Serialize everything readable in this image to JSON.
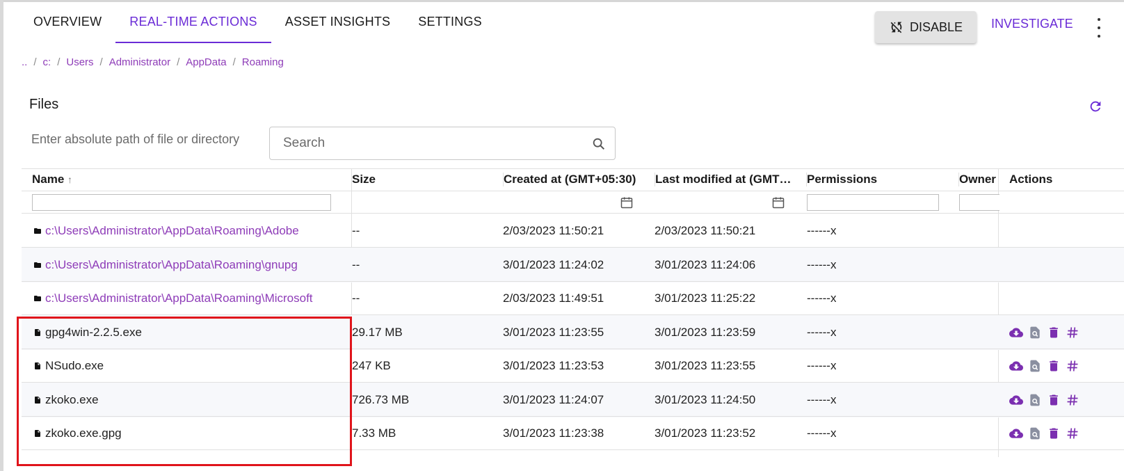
{
  "tabs": [
    "OVERVIEW",
    "REAL-TIME ACTIONS",
    "ASSET INSIGHTS",
    "SETTINGS"
  ],
  "active_tab": "REAL-TIME ACTIONS",
  "toolbar": {
    "disable_label": "DISABLE",
    "investigate_label": "INVESTIGATE"
  },
  "breadcrumb": [
    "..",
    "c:",
    "Users",
    "Administrator",
    "AppData",
    "Roaming"
  ],
  "files": {
    "title": "Files",
    "path_label": "Enter absolute path of file or directory",
    "search_placeholder": "Search"
  },
  "columns": {
    "name": "Name",
    "size": "Size",
    "created": "Created at (GMT+05:30)",
    "modified": "Last modified at (GMT…",
    "permissions": "Permissions",
    "owner": "Owner",
    "actions": "Actions"
  },
  "sort_indicator": "↑",
  "rows": [
    {
      "type": "folder",
      "name": "c:\\Users\\Administrator\\AppData\\Roaming\\Adobe",
      "size": "--",
      "created": "2/03/2023 11:50:21",
      "modified": "2/03/2023 11:50:21",
      "permissions": "------x"
    },
    {
      "type": "folder",
      "name": "c:\\Users\\Administrator\\AppData\\Roaming\\gnupg",
      "size": "--",
      "created": "3/01/2023 11:24:02",
      "modified": "3/01/2023 11:24:06",
      "permissions": "------x"
    },
    {
      "type": "folder",
      "name": "c:\\Users\\Administrator\\AppData\\Roaming\\Microsoft",
      "size": "--",
      "created": "2/03/2023 11:49:51",
      "modified": "3/01/2023 11:25:22",
      "permissions": "------x"
    },
    {
      "type": "file",
      "name": "gpg4win-2.2.5.exe",
      "size": "29.17 MB",
      "created": "3/01/2023 11:23:55",
      "modified": "3/01/2023 11:23:59",
      "permissions": "------x"
    },
    {
      "type": "file",
      "name": "NSudo.exe",
      "size": "247 KB",
      "created": "3/01/2023 11:23:53",
      "modified": "3/01/2023 11:23:55",
      "permissions": "------x"
    },
    {
      "type": "file",
      "name": "zkoko.exe",
      "size": "726.73 MB",
      "created": "3/01/2023 11:24:07",
      "modified": "3/01/2023 11:24:50",
      "permissions": "------x"
    },
    {
      "type": "file",
      "name": "zkoko.exe.gpg",
      "size": "7.33 MB",
      "created": "3/01/2023 11:23:38",
      "modified": "3/01/2023 11:23:52",
      "permissions": "------x"
    }
  ],
  "row_actions": [
    "download-icon",
    "inspect-icon",
    "delete-icon",
    "hash-icon"
  ],
  "colors": {
    "accent": "#6a2bd6",
    "link": "#8e3cb8",
    "highlight": "#e0141b"
  }
}
